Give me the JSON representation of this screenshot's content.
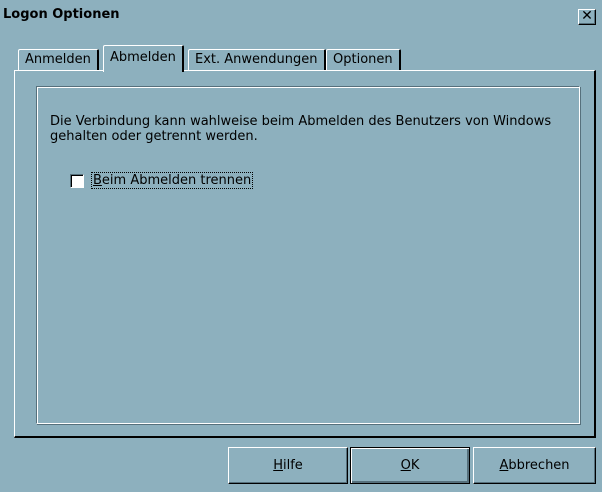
{
  "window": {
    "title": "Logon Optionen",
    "close_glyph": "✕"
  },
  "tabs": [
    {
      "label": "Anmelden",
      "active": false
    },
    {
      "label": "Abmelden",
      "active": true
    },
    {
      "label": "Ext. Anwendungen",
      "active": false
    },
    {
      "label": "Optionen",
      "active": false
    }
  ],
  "abmelden": {
    "description": "Die Verbindung kann wahlweise beim Abmelden des Benutzers von Windows gehalten oder getrennt werden.",
    "checkbox": {
      "label_mnemonic": "B",
      "label_rest": "eim Abmelden trennen",
      "checked": false
    }
  },
  "buttons": {
    "help": {
      "mnemonic": "H",
      "rest": "ilfe"
    },
    "ok": {
      "mnemonic": "O",
      "rest": "K"
    },
    "cancel": {
      "mnemonic": "A",
      "rest": "bbrechen"
    }
  },
  "colors": {
    "face": "#8db0be",
    "shadow": "#56707c",
    "highlight": "#ffffff"
  }
}
